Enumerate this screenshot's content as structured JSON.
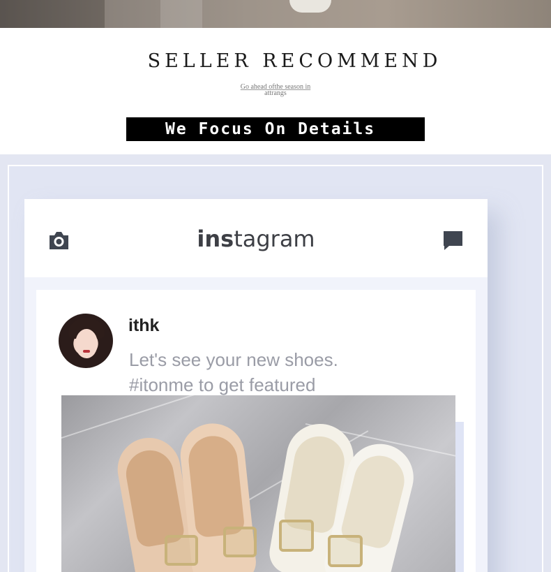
{
  "seller_section": {
    "title": "SELLER RECOMMEND",
    "subtitle_line1": "Go ahead ofthe season in",
    "subtitle_line2": "attrangs",
    "banner": "We Focus On Details"
  },
  "instagram": {
    "logo_bold": "ins",
    "logo_rest": "tagram",
    "header_left_icon": "camera-icon",
    "header_right_icon": "message-icon"
  },
  "post": {
    "username": "ithk",
    "caption_line1": "Let's see your new shoes.",
    "caption_line2": "#itonme to get featured"
  },
  "colors": {
    "background_lower": "#e3e6f2",
    "icon_gray": "#3f4550",
    "caption_gray": "#9a9ca6",
    "banner_black": "#000000"
  }
}
